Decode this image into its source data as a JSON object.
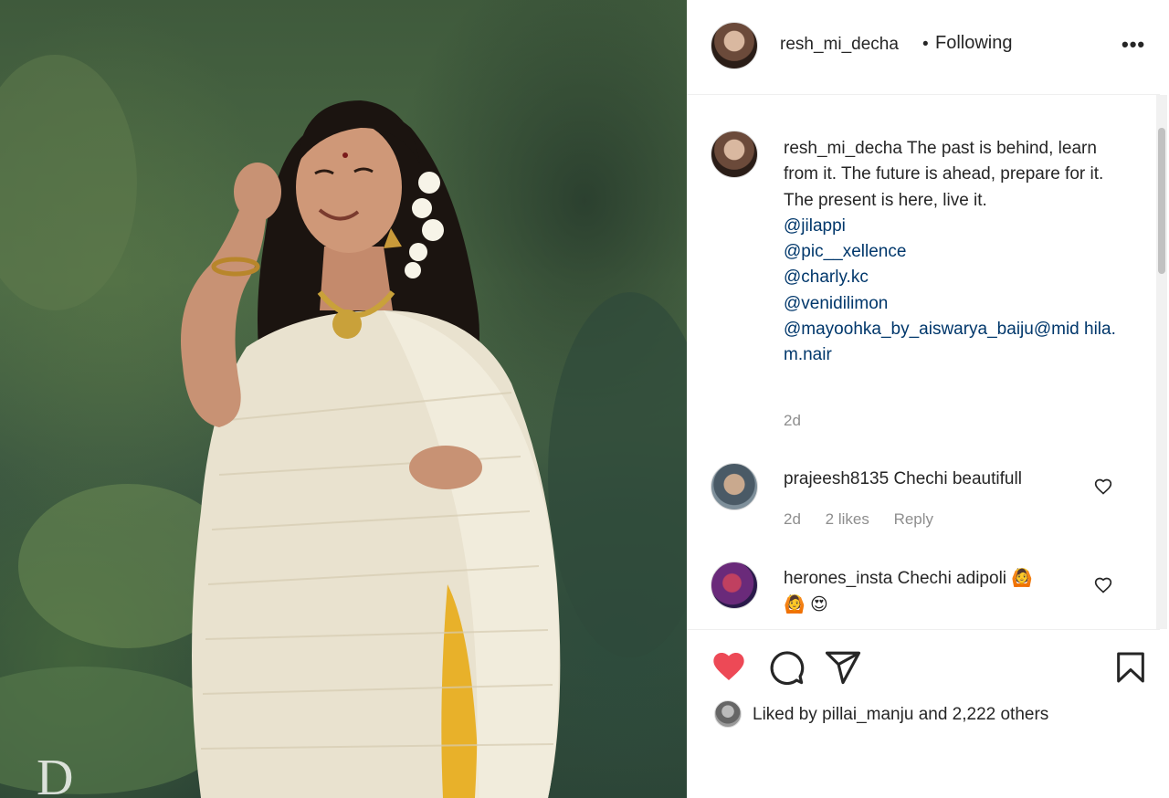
{
  "post_image": {
    "watermark": "D"
  },
  "header": {
    "username": "resh_mi_decha",
    "separator": "•",
    "follow_status": "Following",
    "more_icon": "more-options-icon"
  },
  "caption": {
    "username": "resh_mi_decha",
    "text": "The past is behind, learn from it. The future is ahead, prepare for it. The present is here, live it.",
    "mentions": [
      "@jilappi",
      "@pic__xellence",
      "@charly.kc",
      "@venidilimon",
      "@mayoohka_by_aiswarya_baiju@mid hila.m.nair"
    ],
    "time": "2d"
  },
  "comments": [
    {
      "username": "prajeesh8135",
      "text": "Chechi beautifull",
      "time": "2d",
      "likes": "2 likes",
      "reply": "Reply"
    },
    {
      "username": "herones_insta",
      "text": "Chechi adipoli",
      "emojis": [
        "🙆",
        "🙆",
        "😍"
      ]
    }
  ],
  "actions": {
    "like_icon": "heart-filled-icon",
    "comment_icon": "comment-icon",
    "share_icon": "share-icon",
    "save_icon": "bookmark-icon",
    "like_color": "#ed4956"
  },
  "likes_line": {
    "prefix": "Liked by",
    "user": "pillai_manju",
    "suffix": "and 2,222 others"
  }
}
